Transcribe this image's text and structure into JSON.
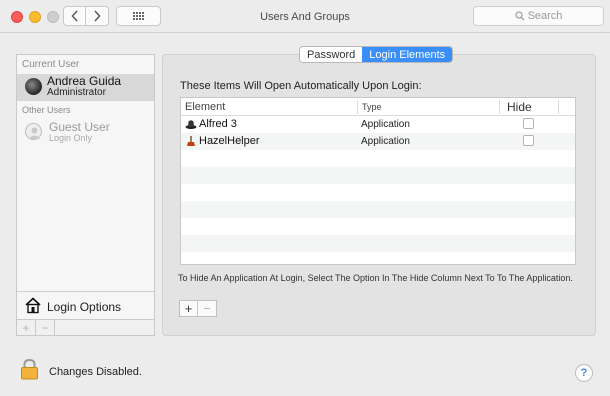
{
  "window": {
    "title": "Users And Groups",
    "search_placeholder": "Search"
  },
  "sidebar": {
    "current_user_header": "Current User",
    "current_user": {
      "name": "Andrea Guida",
      "role": "Administrator"
    },
    "other_users_header": "Other Users",
    "other_users": [
      {
        "name": "Guest User",
        "role": "Login Only"
      }
    ],
    "login_options_label": "Login Options",
    "add_label": "+",
    "remove_label": "−"
  },
  "tabs": [
    {
      "label": "Password",
      "active": false
    },
    {
      "label": "Login Elements",
      "active": true
    }
  ],
  "panel": {
    "title": "These Items Will Open Automatically Upon Login:",
    "columns": {
      "element": "Element",
      "type": "Type",
      "hide": "Hide"
    },
    "items": [
      {
        "name": "Alfred 3",
        "type": "Application",
        "hide": false,
        "icon": "alfred-hat-icon"
      },
      {
        "name": "HazelHelper",
        "type": "Application",
        "hide": false,
        "icon": "hazel-broom-icon"
      }
    ],
    "hint": "To Hide An Application At Login, Select The Option In The Hide Column Next To To The Application.",
    "add_label": "+",
    "remove_label": "−"
  },
  "footer": {
    "lock_label": "Changes Disabled.",
    "help_label": "?"
  },
  "colors": {
    "accent": "#3a8ef7",
    "close": "#fc5f57",
    "minimize": "#fdbc2e"
  }
}
